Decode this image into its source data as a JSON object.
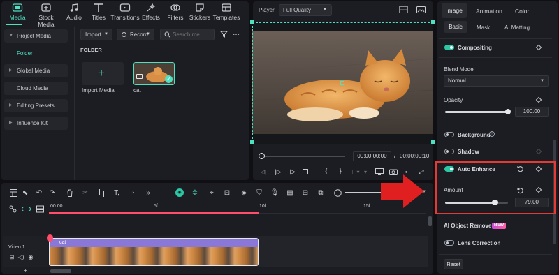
{
  "toolbar": {
    "items": [
      {
        "label": "Media",
        "icon": "media-icon",
        "active": true
      },
      {
        "label": "Stock Media",
        "icon": "stock-media-icon"
      },
      {
        "label": "Audio",
        "icon": "audio-icon"
      },
      {
        "label": "Titles",
        "icon": "titles-icon"
      },
      {
        "label": "Transitions",
        "icon": "transitions-icon"
      },
      {
        "label": "Effects",
        "icon": "effects-icon"
      },
      {
        "label": "Filters",
        "icon": "filters-icon"
      },
      {
        "label": "Stickers",
        "icon": "stickers-icon"
      },
      {
        "label": "Templates",
        "icon": "templates-icon"
      }
    ]
  },
  "sidebar": {
    "items": [
      {
        "label": "Project Media",
        "expanded": true
      },
      {
        "label": "Folder",
        "selected": true
      },
      {
        "label": "Global Media"
      },
      {
        "label": "Cloud Media"
      },
      {
        "label": "Editing Presets"
      },
      {
        "label": "Influence Kit"
      }
    ]
  },
  "media": {
    "import_label": "Import",
    "record_label": "Record",
    "search_placeholder": "Search me...",
    "folder_heading": "FOLDER",
    "import_tile_label": "Import Media",
    "clip_label": "cat"
  },
  "player": {
    "label": "Player",
    "quality": "Full Quality",
    "current_time": "00:00:00:00",
    "separator": "/",
    "total_time": "00:00:00:10"
  },
  "properties": {
    "tabs": [
      "Image",
      "Animation",
      "Color"
    ],
    "active_tab": "Image",
    "subtabs": [
      "Basic",
      "Mask",
      "AI Matting"
    ],
    "active_subtab": "Basic",
    "compositing_label": "Compositing",
    "blend_mode_label": "Blend Mode",
    "blend_mode_value": "Normal",
    "opacity_label": "Opacity",
    "opacity_value": "100.00",
    "opacity_fraction": 1.0,
    "background_label": "Background",
    "shadow_label": "Shadow",
    "auto_enhance_label": "Auto Enhance",
    "amount_label": "Amount",
    "amount_value": "79.00",
    "amount_fraction": 0.79,
    "ai_object_remover_label": "AI Object Remover",
    "new_badge": "NEW",
    "lens_correction_label": "Lens Correction",
    "reset_label": "Reset"
  },
  "timeline": {
    "ruler": [
      "00:00",
      "5f",
      "10f",
      "15f"
    ],
    "track_label": "Video 1",
    "clip_label": "cat"
  },
  "colors": {
    "accent": "#4fe0c2",
    "highlight_box": "#e53935",
    "arrow": "#e02020",
    "clip": "#8a78d8",
    "playhead": "#ff4d6a"
  }
}
